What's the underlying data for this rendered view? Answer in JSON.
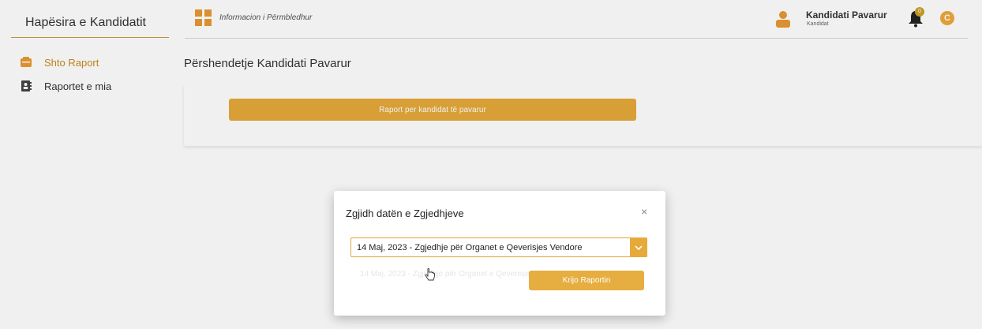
{
  "sidebar": {
    "brand": "Hapësira e Kandidatit",
    "items": [
      {
        "label": "Shto Raport",
        "icon": "add-report-icon",
        "active": true
      },
      {
        "label": "Raportet e mia",
        "icon": "contacts-book-icon",
        "active": false
      }
    ]
  },
  "topbar": {
    "title": "Informacion i Përmbledhur",
    "user_name": "Kandidati Pavarur",
    "user_role": "Kandidat",
    "notification_count": "0",
    "avatar_letter": "C"
  },
  "main": {
    "greeting": "Përshendetje Kandidati Pavarur",
    "report_button": "Raport per kandidat të pavarur"
  },
  "modal": {
    "title": "Zgjidh datën e Zgjedhjeve",
    "close": "×",
    "selected_option": "14 Maj, 2023 - Zgjedhje për Organet e Qeverisjes Vendore",
    "ghost_option": "14 Maj, 2023 - Zgjedhje për Organet e Qeverisjes",
    "create_button": "Krijo Raportin"
  },
  "colors": {
    "accent": "#e6a93a",
    "active_text": "#c98a1b"
  }
}
